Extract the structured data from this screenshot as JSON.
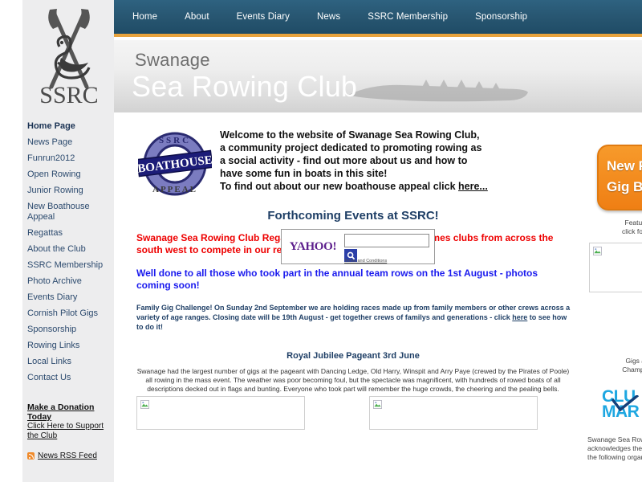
{
  "nav": {
    "items": [
      {
        "label": "Home"
      },
      {
        "label": "About"
      },
      {
        "label": "Events Diary"
      },
      {
        "label": "News"
      },
      {
        "label": "SSRC Membership"
      },
      {
        "label": "Sponsorship"
      }
    ]
  },
  "logo": {
    "text": "SSRC"
  },
  "banner": {
    "sub": "Swanage",
    "main": "Sea Rowing Club"
  },
  "sidebar": {
    "items": [
      {
        "label": "Home Page",
        "active": true
      },
      {
        "label": "News Page",
        "active": false
      },
      {
        "label": "Funrun2012",
        "active": false
      },
      {
        "label": "Open Rowing",
        "active": false
      },
      {
        "label": "Junior Rowing",
        "active": false
      },
      {
        "label": "New Boathouse Appeal",
        "active": false
      },
      {
        "label": "Regattas",
        "active": false
      },
      {
        "label": "About the Club",
        "active": false
      },
      {
        "label": "SSRC Membership",
        "active": false
      },
      {
        "label": "Photo Archive",
        "active": false
      },
      {
        "label": "Events Diary",
        "active": false
      },
      {
        "label": "Cornish Pilot Gigs",
        "active": false
      },
      {
        "label": "Sponsorship",
        "active": false
      },
      {
        "label": "Rowing Links",
        "active": false
      },
      {
        "label": "Local Links",
        "active": false
      },
      {
        "label": "Contact Us",
        "active": false
      }
    ],
    "donate_title": "Make a Donation Today",
    "donate_sub": "Click Here to Support the Club",
    "rss_label": "News RSS Feed",
    "rss_icon": "rss-icon"
  },
  "welcome": {
    "appeal_logo": {
      "top": "SSRC",
      "band": "BOATHOUSE",
      "bottom": "APPEAL"
    },
    "line1": "Welcome to the website of Swanage Sea Rowing Club,",
    "line2": "a community project dedicated to promoting rowing as",
    "line3": "a social activity  - find out more about us and how to",
    "line4": "have some fun in boats in this site!",
    "line5_pre": "To find out about our new boathouse appeal click ",
    "line5_link": "here..."
  },
  "yahoo": {
    "brand": "YAHOO!",
    "input_value": "",
    "placeholder": "",
    "search_icon": "magnifier-icon",
    "terms": "Terms and Conditions"
  },
  "events": {
    "title": "Forthcoming Events at SSRC!",
    "red_notice": "Swanage Sea Rowing Club Regatta 1st September - SSRC welcomes clubs from across the south west to compete in our regatta - more news soon.",
    "blue_notice": "Well done to all those who took part in the annual team rows on the 1st August - photos coming soon!",
    "gig_pre": "Family Gig Challenge!  On Sunday 2nd September we are holding races made up from family members or  other crews across a variety of age ranges. Closing date will be 19th August - get together crews  of familys and generations - click ",
    "gig_link": "here",
    "gig_post": " to see how to do it!"
  },
  "jubilee": {
    "title": "Royal Jubilee Pageant 3rd June",
    "body": "Swanage had the largest number of gigs at the pageant with Dancing Ledge, Old Harry, Winspit and Arry Paye (crewed by the Pirates of Poole) all rowing in the mass event. The weather was poor becoming foul, but the spectacle was magnificent, with hundreds of rowed boats of all descriptions decked out in flags and bunting. Everyone who took part will remember the huge crowds, the cheering and the pealing bells."
  },
  "rail": {
    "banner_line1": "New P",
    "banner_line2": "Gig B",
    "caption1_line1": "Featured pi",
    "caption1_line2": "click for large",
    "caption2_line1": "Gigs at the",
    "caption2_line2": "Championshi",
    "clubmark_line1": "CLU",
    "clubmark_line2": "MAR",
    "ack_line1": "Swanage Sea Row",
    "ack_line2": "acknowledges the",
    "ack_line3": "the following organ"
  },
  "colors": {
    "nav_bg": "#275570",
    "nav_accent": "#e8a33d",
    "sidebar_bg": "#ededee",
    "link_blue": "#2c4a6e",
    "notice_red": "#ee0000",
    "notice_blue": "#1a1aee",
    "heading_blue": "#1f3f66",
    "orange": "#ef7f14",
    "clubmark_blue": "#1ea7e1"
  }
}
